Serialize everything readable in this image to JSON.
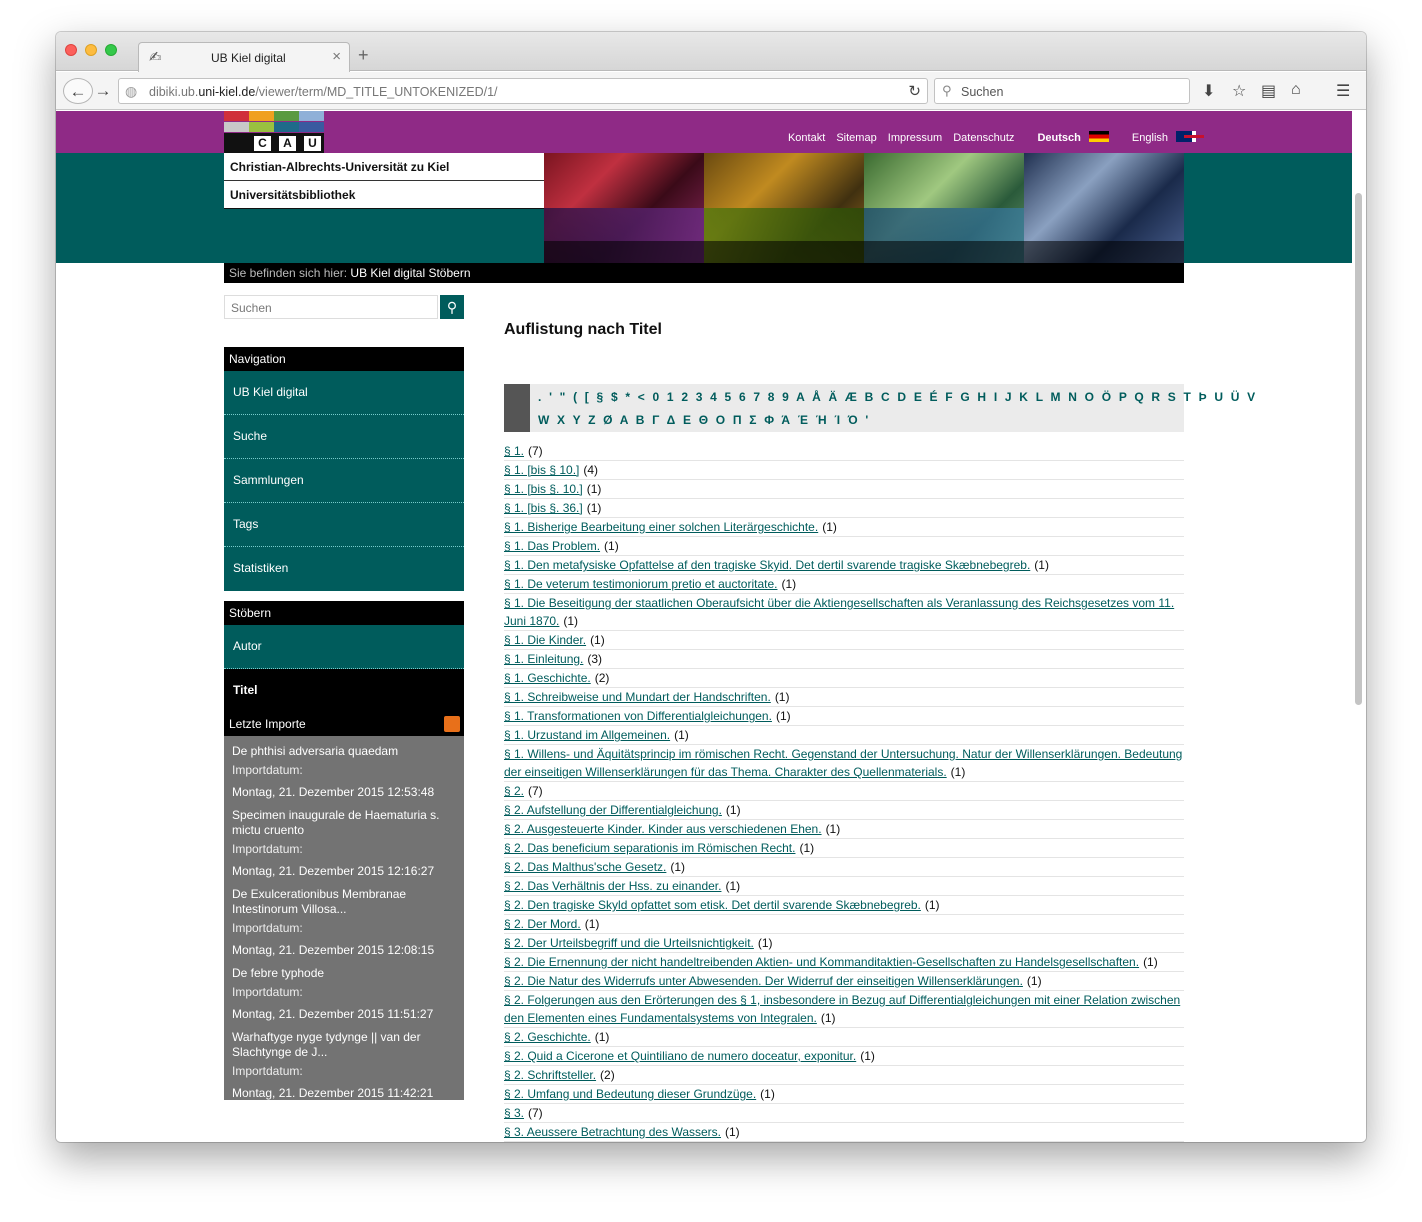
{
  "browser": {
    "tab_title": "UB Kiel digital",
    "url_prefix": "dibiki.ub.",
    "url_domain": "uni-kiel.de",
    "url_path": "/viewer/term/MD_TITLE_UNTOKENIZED/1/",
    "search_placeholder": "Suchen"
  },
  "header": {
    "logo_letters": [
      "C",
      "A",
      "U"
    ],
    "links": [
      "Kontakt",
      "Sitemap",
      "Impressum",
      "Datenschutz"
    ],
    "lang_de": "Deutsch",
    "lang_en": "English",
    "university": "Christian-Albrechts-Universität zu Kiel",
    "library": "Universitätsbibliothek",
    "breadcrumb_prefix": "Sie befinden sich hier:",
    "breadcrumb_trail": "UB Kiel digital Stöbern"
  },
  "sidebar": {
    "search_placeholder": "Suchen",
    "nav_title": "Navigation",
    "nav_items": [
      "UB Kiel digital",
      "Suche",
      "Sammlungen",
      "Tags",
      "Statistiken"
    ],
    "browse_title": "Stöbern",
    "browse_items": [
      "Autor",
      "Titel"
    ],
    "imports_title": "Letzte Importe",
    "import_label": "Importdatum:",
    "imports": [
      {
        "title": "De phthisi adversaria quaedam",
        "date": "Montag, 21. Dezember 2015 12:53:48"
      },
      {
        "title": "Specimen inaugurale de Haematuria s. mictu cruento",
        "date": "Montag, 21. Dezember 2015 12:16:27"
      },
      {
        "title": "De Exulcerationibus Membranae Intestinorum Villosa...",
        "date": "Montag, 21. Dezember 2015 12:08:15"
      },
      {
        "title": "De febre typhode",
        "date": "Montag, 21. Dezember 2015 11:51:27"
      },
      {
        "title": "Warhaftyge nyge tydynge || van der Slachtynge de J...",
        "date": "Montag, 21. Dezember 2015 11:42:21"
      }
    ]
  },
  "main": {
    "title": "Auflistung nach Titel",
    "alphabet_row1": ". ' \" ( [ § $ * < 0 1 2 3 4 5 6 7 8 9 A Å Ä Æ B C D E É F G H I J K L M N O Ö P Q R S T Þ U Ü V",
    "alphabet_row2": "W X Y Z Ø A B Γ Δ E Θ O Π Σ Φ Ά Έ Ή Ί Ό ʹ",
    "entries": [
      {
        "title": "§ 1.",
        "count": "(7)"
      },
      {
        "title": "§ 1. [bis § 10.]",
        "count": "(4)"
      },
      {
        "title": "§ 1. [bis §. 10.]",
        "count": "(1)"
      },
      {
        "title": "§ 1. [bis §. 36.]",
        "count": "(1)"
      },
      {
        "title": "§ 1. Bisherige Bearbeitung einer solchen Literärgeschichte.",
        "count": "(1)"
      },
      {
        "title": "§ 1. Das Problem.",
        "count": "(1)"
      },
      {
        "title": "§ 1. Den metafysiske Opfattelse af den tragiske Skyid. Det dertil svarende tragiske Skæbnebegreb.",
        "count": "(1)"
      },
      {
        "title": "§ 1. De veterum testimoniorum pretio et auctoritate.",
        "count": "(1)"
      },
      {
        "title": "§ 1. Die Beseitigung der staatlichen Oberaufsicht über die Aktiengesellschaften als Veranlassung des Reichsgesetzes vom 11. Juni 1870.",
        "count": "(1)"
      },
      {
        "title": "§ 1. Die Kinder.",
        "count": "(1)"
      },
      {
        "title": "§ 1. Einleitung.",
        "count": "(3)"
      },
      {
        "title": "§ 1. Geschichte.",
        "count": "(2)"
      },
      {
        "title": "§ 1. Schreibweise und Mundart der Handschriften.",
        "count": "(1)"
      },
      {
        "title": "§ 1. Transformationen von Differentialgleichungen.",
        "count": "(1)"
      },
      {
        "title": "§ 1. Urzustand im Allgemeinen.",
        "count": "(1)"
      },
      {
        "title": "§ 1. Willens- und Äquitätsprincip im römischen Recht. Gegenstand der Untersuchung. Natur der Willenserklärungen. Bedeutung der einseitigen Willenserklärungen für das Thema. Charakter des Quellenmaterials.",
        "count": "(1)"
      },
      {
        "title": "§ 2.",
        "count": "(7)"
      },
      {
        "title": "§ 2. Aufstellung der Differentialgleichung.",
        "count": "(1)"
      },
      {
        "title": "§ 2. Ausgesteuerte Kinder. Kinder aus verschiedenen Ehen.",
        "count": "(1)"
      },
      {
        "title": "§ 2. Das beneficium separationis im Römischen Recht.",
        "count": "(1)"
      },
      {
        "title": "§ 2. Das Malthus'sche Gesetz.",
        "count": "(1)"
      },
      {
        "title": "§ 2. Das Verhältnis der Hss. zu einander.",
        "count": "(1)"
      },
      {
        "title": "§ 2. Den tragiske Skyld opfattet som etisk. Det dertil svarende Skæbnebegreb.",
        "count": "(1)"
      },
      {
        "title": "§ 2. Der Mord.",
        "count": "(1)"
      },
      {
        "title": "§ 2. Der Urteilsbegriff und die Urteilsnichtigkeit.",
        "count": "(1)"
      },
      {
        "title": "§ 2. Die Ernennung der nicht handeltreibenden Aktien- und Kommanditaktien-Gesellschaften zu Handelsgesellschaften.",
        "count": "(1)"
      },
      {
        "title": "§ 2. Die Natur des Widerrufs unter Abwesenden. Der Widerruf der einseitigen Willenserklärungen.",
        "count": "(1)"
      },
      {
        "title": "§ 2. Folgerungen aus den Erörterungen des § 1, insbesondere in Bezug auf Differentialgleichungen mit einer Relation zwischen den Elementen eines Fundamentalsystems von Integralen.",
        "count": "(1)"
      },
      {
        "title": "§ 2. Geschichte.",
        "count": "(1)"
      },
      {
        "title": "§ 2. Quid a Cicerone et Quintiliano de numero doceatur, exponitur.",
        "count": "(1)"
      },
      {
        "title": "§ 2. Schriftsteller.",
        "count": "(2)"
      },
      {
        "title": "§ 2. Umfang und Bedeutung dieser Grundzüge.",
        "count": "(1)"
      },
      {
        "title": "§ 3.",
        "count": "(7)"
      },
      {
        "title": "§ 3. Aeussere Betrachtung des Wassers.",
        "count": "(1)"
      }
    ]
  },
  "colors": {
    "purple": "#8f2a86",
    "teal": "#005c5c",
    "black": "#000000",
    "import_gray": "#737373"
  }
}
